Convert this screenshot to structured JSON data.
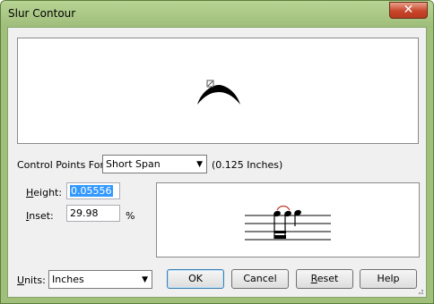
{
  "window": {
    "title": "Slur Contour",
    "close_glyph": "✕"
  },
  "control_points": {
    "label": "Control Points For:",
    "selected": "Short Span",
    "span_info": "(0.125 Inches)"
  },
  "height": {
    "label": "Height:",
    "value": "0.05556"
  },
  "inset": {
    "label": "Inset:",
    "value": "29.98",
    "unit": "%"
  },
  "units": {
    "label": "Units:",
    "selected": "Inches"
  },
  "buttons": {
    "ok": "OK",
    "cancel": "Cancel",
    "reset": "Reset",
    "help": "Help"
  },
  "colors": {
    "titlebar": "#a9c889",
    "close": "#c8452a",
    "slur_preview": "#c0392b"
  },
  "icons": {
    "dropdown": "chevron-down-icon",
    "close": "close-icon"
  }
}
